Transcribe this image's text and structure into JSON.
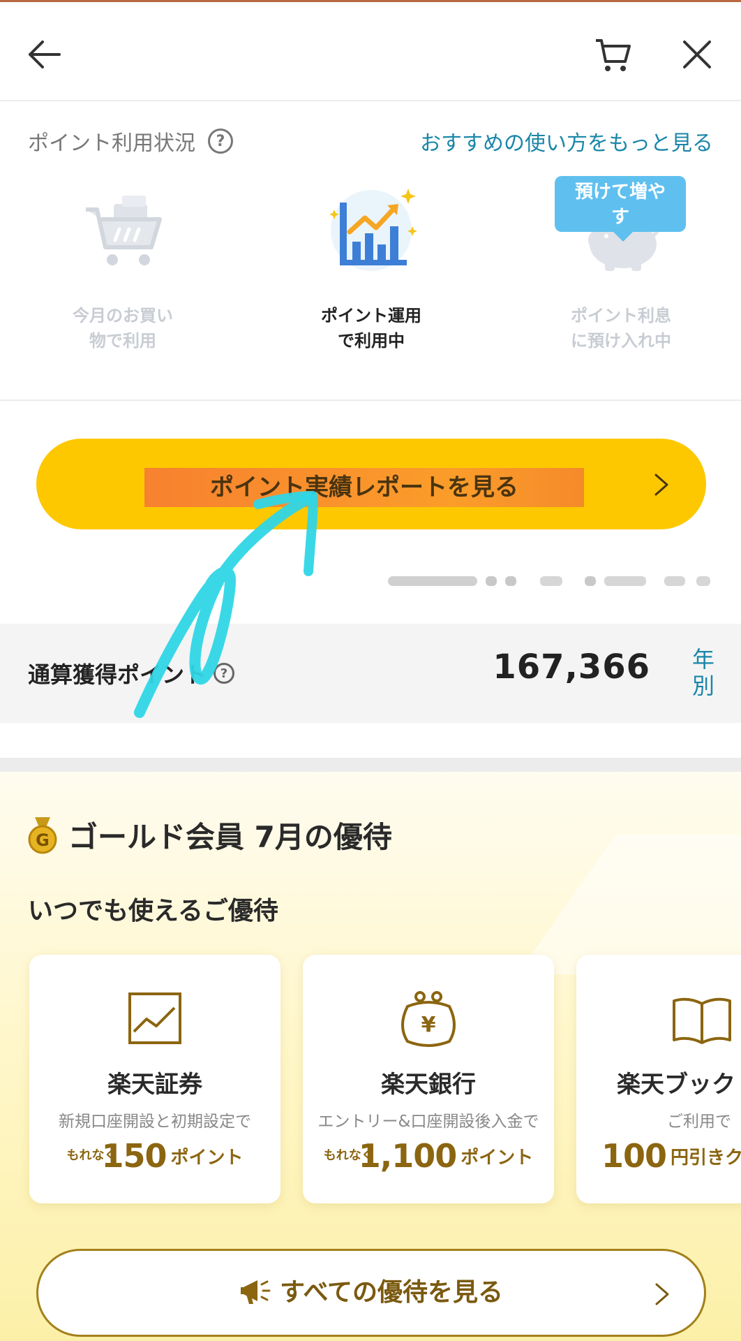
{
  "header": {
    "back_icon": "arrow-left-icon",
    "cart_icon": "cart-icon",
    "close_icon": "close-icon"
  },
  "usage": {
    "title": "ポイント利用状況",
    "help_icon_text": "?",
    "more_link": "おすすめの使い方をもっと見る",
    "items": [
      {
        "label_line1": "今月のお買い",
        "label_line2": "物で利用",
        "icon": "shopping-cart-icon",
        "active": false
      },
      {
        "label_line1": "ポイント運用",
        "label_line2": "で利用中",
        "icon": "investment-chart-icon",
        "active": true
      },
      {
        "label_line1": "ポイント利息",
        "label_line2": "に預け入れ中",
        "icon": "piggy-bank-icon",
        "active": false
      }
    ],
    "bubble_line1": "預けて増や",
    "bubble_line2": "す"
  },
  "report_button": {
    "label": "ポイント実績レポートを見る"
  },
  "total": {
    "label": "通算獲得ポイント",
    "help_icon_text": "?",
    "value": "167,366",
    "link_line1": "年",
    "link_line2": "別"
  },
  "gold": {
    "title": "ゴールド会員 7月の優待",
    "medal_letter": "G",
    "subtitle": "いつでも使えるご優待",
    "cards": [
      {
        "name": "楽天証券",
        "desc": "新規口座開設と初期設定で",
        "offer_pre": "もれなく",
        "offer_num": "150",
        "offer_suf": "ポイント",
        "icon": "chart-icon"
      },
      {
        "name": "楽天銀行",
        "desc": "エントリー&口座開設後入金で",
        "offer_pre": "もれなく",
        "offer_num": "1,100",
        "offer_suf": "ポイント",
        "icon": "wallet-yen-icon"
      },
      {
        "name": "楽天ブック",
        "desc": "ご利用で",
        "offer_num": "100",
        "offer_suf": "円引きク",
        "icon": "book-icon"
      }
    ],
    "all_button": {
      "label": "すべての優待を見る",
      "icon": "megaphone-icon"
    }
  },
  "colors": {
    "accent_yellow": "#fdc800",
    "link_blue": "#1a86a8",
    "gold_text": "#8b6510",
    "annotation_cyan": "#2fd6e6"
  }
}
